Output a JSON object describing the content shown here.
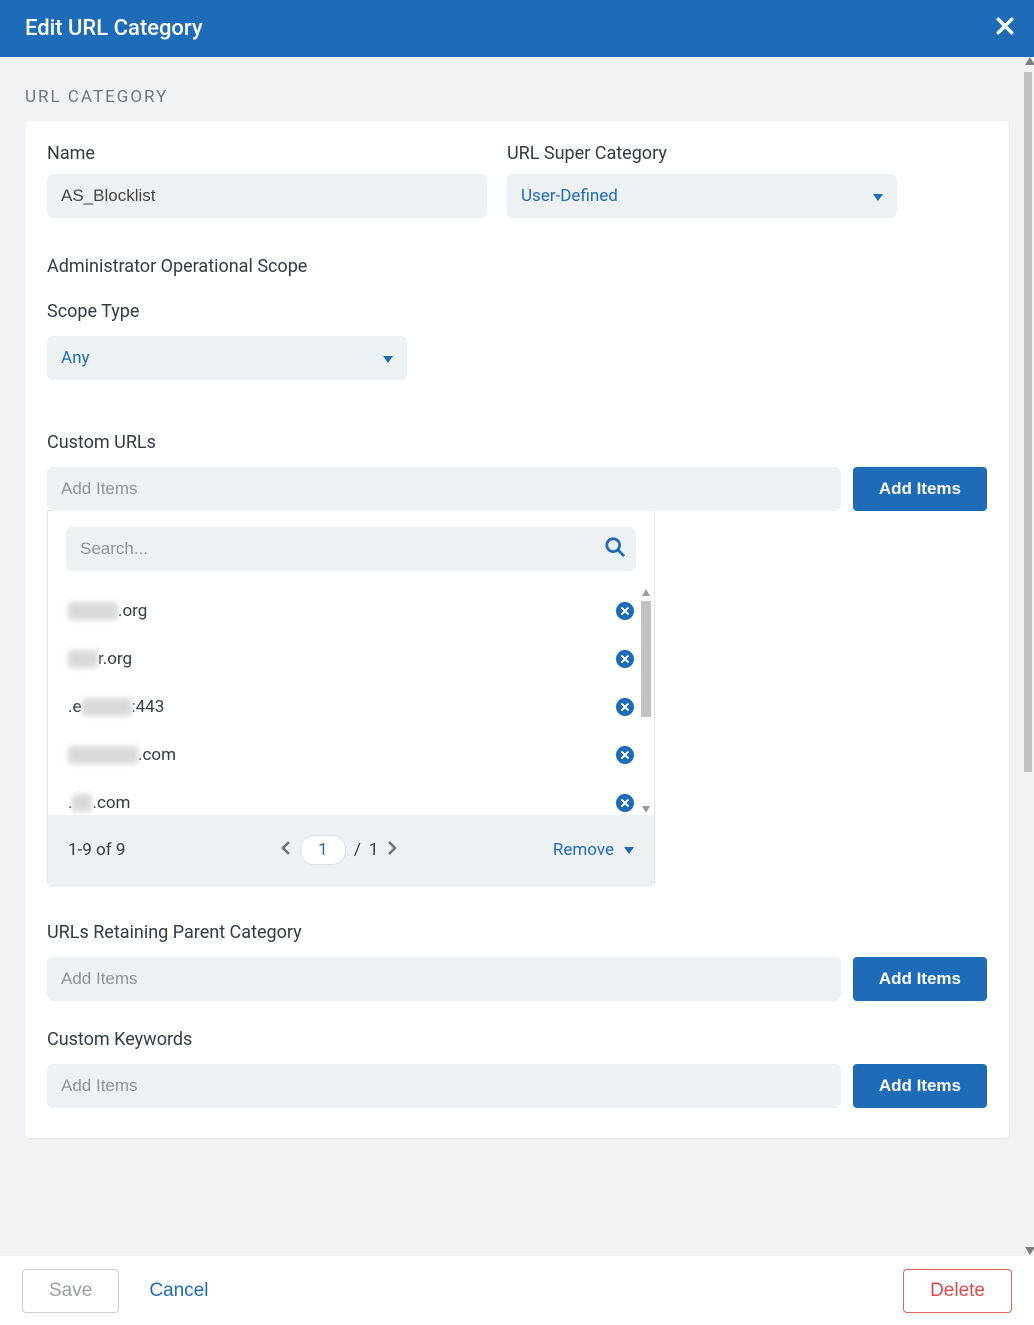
{
  "header": {
    "title": "Edit URL Category"
  },
  "sectionTitle": "URL CATEGORY",
  "fields": {
    "name": {
      "label": "Name",
      "value": "AS_Blocklist"
    },
    "superCategory": {
      "label": "URL Super Category",
      "value": "User-Defined"
    },
    "adminScope": {
      "label": "Administrator Operational Scope"
    },
    "scopeType": {
      "label": "Scope Type",
      "value": "Any"
    },
    "customUrls": {
      "label": "Custom URLs",
      "placeholder": "Add Items",
      "button": "Add Items",
      "searchPlaceholder": "Search...",
      "items": [
        {
          "obscured": "xxxxx",
          "suffix": ".org"
        },
        {
          "obscured": "xxx",
          "suffix": "r.org"
        },
        {
          "prefix": ".e",
          "obscured": "xxxxx",
          "suffix": ":443"
        },
        {
          "obscured": "xxxxxxx",
          "suffix": ".com"
        },
        {
          "prefix": ".",
          "obscured": "xx",
          "suffix": ".com"
        }
      ],
      "pager": {
        "range": "1-9 of 9",
        "page": "1",
        "totalPages": "1",
        "removeLabel": "Remove"
      }
    },
    "retaining": {
      "label": "URLs Retaining Parent Category",
      "placeholder": "Add Items",
      "button": "Add Items"
    },
    "keywords": {
      "label": "Custom Keywords",
      "placeholder": "Add Items",
      "button": "Add Items"
    }
  },
  "footer": {
    "save": "Save",
    "cancel": "Cancel",
    "delete": "Delete"
  }
}
